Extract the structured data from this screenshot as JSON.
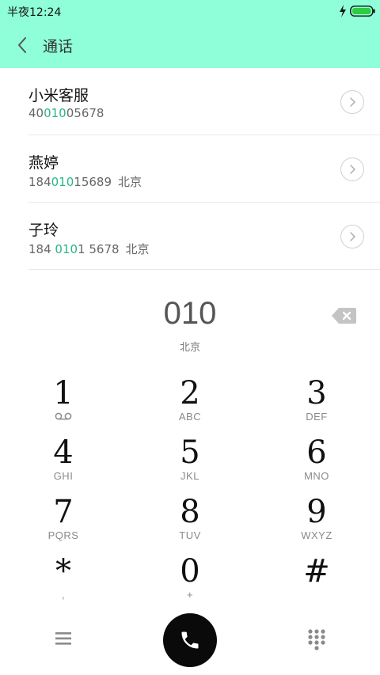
{
  "status_bar": {
    "time": "半夜12:24",
    "charging_icon": "lightning-icon",
    "battery_icon": "battery-full-icon",
    "battery_color": "#2ecc40"
  },
  "header": {
    "title": "通话",
    "back_icon": "chevron-left-icon",
    "background": "#8effd8"
  },
  "contacts": [
    {
      "name": "小米客服",
      "number_prefix": "40",
      "number_match": "010",
      "number_suffix": "05678",
      "location": ""
    },
    {
      "name": "燕婷",
      "number_prefix": "184",
      "number_match": "010",
      "number_suffix": "15689",
      "location": "北京"
    },
    {
      "name": "子玲",
      "number_prefix": "184 ",
      "number_match": "010",
      "number_suffix": "1 5678",
      "location": "北京"
    }
  ],
  "dialer": {
    "number": "010",
    "location": "北京",
    "backspace_icon": "backspace-icon",
    "highlight_color": "#27b883"
  },
  "keypad": [
    {
      "digit": "1",
      "letters": "",
      "icon": "voicemail-icon"
    },
    {
      "digit": "2",
      "letters": "ABC"
    },
    {
      "digit": "3",
      "letters": "DEF"
    },
    {
      "digit": "4",
      "letters": "GHI"
    },
    {
      "digit": "5",
      "letters": "JKL"
    },
    {
      "digit": "6",
      "letters": "MNO"
    },
    {
      "digit": "7",
      "letters": "PQRS"
    },
    {
      "digit": "8",
      "letters": "TUV"
    },
    {
      "digit": "9",
      "letters": "WXYZ"
    },
    {
      "digit": "*",
      "letters": ","
    },
    {
      "digit": "0",
      "letters": "+"
    },
    {
      "digit": "#",
      "letters": ""
    }
  ],
  "bottom_bar": {
    "menu_icon": "menu-icon",
    "call_icon": "phone-icon",
    "dialpad_icon": "dialpad-icon"
  }
}
